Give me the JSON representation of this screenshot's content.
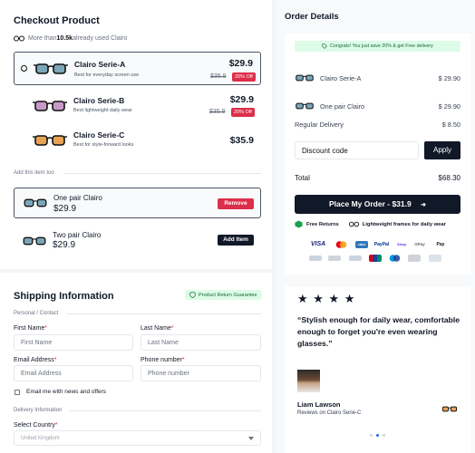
{
  "checkout": {
    "title": "Checkout Product",
    "social_proof_prefix": "More than ",
    "social_proof_count": "10.5k",
    "social_proof_suffix": " already used Clairo",
    "products": [
      {
        "name": "Clairo Serie-A",
        "desc": "Best for everyday screen use",
        "price": "$29.9",
        "old_price": "$35.9",
        "badge": "20% Off",
        "lens": "#7aa6b8"
      },
      {
        "name": "Clairo Serie-B",
        "desc": "Best lightweight daily wear",
        "price": "$29.9",
        "old_price": "$35.9",
        "badge": "20% Off",
        "lens": "#c79ac6"
      },
      {
        "name": "Clairo Serie-C",
        "desc": "Best for style-forward looks",
        "price": "$35.9",
        "lens": "#e8a356"
      }
    ],
    "addon_label": "Add this item too",
    "addons": [
      {
        "name": "One pair Clairo",
        "price": "$29.9",
        "button": "Remove"
      },
      {
        "name": "Two pair Clairo",
        "price": "$29.9",
        "button": "Add Item"
      }
    ]
  },
  "shipping": {
    "title": "Shipping Information",
    "guarantee": "Product Return Guarantee",
    "section_personal": "Personal / Contact",
    "first_name_label": "First Name",
    "first_name_placeholder": "First Name",
    "last_name_label": "Last Name",
    "last_name_placeholder": "Last Name",
    "email_label": "Email Address",
    "email_placeholder": "Email Address",
    "phone_label": "Phone number",
    "phone_placeholder": "Phone number",
    "newsletter": "Email me with news and offers",
    "section_delivery": "Delivery Information",
    "country_label": "Select Country",
    "country_value": "United Kingdom"
  },
  "order": {
    "title": "Order Details",
    "promo": "Congrats! You just save 20% & get Free delivery",
    "items": [
      {
        "name": "Clairo Serie-A",
        "price": "$ 29.90"
      },
      {
        "name": "One pair Clairo",
        "price": "$ 29.90"
      }
    ],
    "delivery_label": "Regular Delivery",
    "delivery_price": "$ 8.50",
    "discount_placeholder": "Discount code",
    "apply": "Apply",
    "total_label": "Total",
    "total_value": "$68.30",
    "cta": "Place My Order - $31.9",
    "cta_arrow": "➜",
    "free_returns": "Free Returns",
    "lightweight": "Lightweight frames for daily wear",
    "payments": [
      "VISA",
      "●●",
      "AMEX",
      "PayPal",
      "Shop",
      "GPay",
      "Pay",
      "",
      "",
      "",
      "",
      "",
      "",
      ""
    ]
  },
  "review": {
    "stars": "★ ★ ★ ★",
    "quote": "“Stylish enough for daily wear, comfortable enough to forget you're even wearing glasses.”",
    "name": "Liam Lawson",
    "product": "Reviews on Clairo Serie-C"
  },
  "colors": {
    "accent": "#111827",
    "danger": "#dc2f4a",
    "promo_bg": "#dcfce7"
  }
}
